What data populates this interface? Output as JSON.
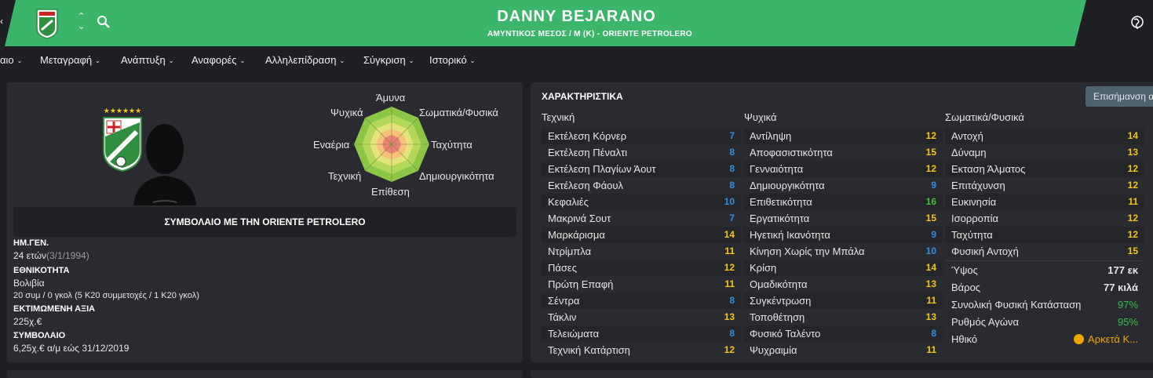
{
  "header": {
    "name": "DANNY BEJARANO",
    "subtitle": "ΑΜΥΝΤΙΚΟΣ ΜΕΣΟΣ / Μ (Κ) - ORIENTE PETROLERO",
    "updown_icon": "⌃⌄",
    "left_fragment": "‹"
  },
  "menu": [
    {
      "label": "αιο"
    },
    {
      "label": "Μεταγραφή"
    },
    {
      "label": "Ανάπτυξη"
    },
    {
      "label": "Αναφορές"
    },
    {
      "label": "Αλληλεπίδραση"
    },
    {
      "label": "Σύγκριση"
    },
    {
      "label": "Ιστορικό"
    }
  ],
  "radar": {
    "labels": [
      "Άμυνα",
      "Σωματικά/Φυσικά",
      "Ταχύτητα",
      "Δημιουργικότητα",
      "Επίθεση",
      "Τεχνική",
      "Εναέρια",
      "Ψυχικά"
    ]
  },
  "contract": {
    "title": "ΣΥΜΒΟΛΑΙΟ ΜΕ ΤΗΝ ORIENTE PETROLERO",
    "dob_label": "ΗΜ.ΓΕΝ.",
    "age": "24 ετών",
    "dob": "(3/1/1994)",
    "nationality_label": "ΕΘΝΙΚΟΤΗΤΑ",
    "nationality": "Βολιβία",
    "caps": "20 συμ / 0 γκολ (5 Κ20 συμμετοχές / 1 Κ20 γκολ)",
    "value_label": "ΕΚΤΙΜΩΜΕΝΗ ΑΞΙΑ",
    "value": "225χ.€",
    "contract_label": "ΣΥΜΒΟΛΑΙΟ",
    "contract_value": "6,25χ.€ α/μ εώς 31/12/2019"
  },
  "attributes": {
    "title": "ΧΑΡΑΚΤΗΡΙΣΤΙΚΑ",
    "highlight_button": "Επισήμανση α",
    "columns": [
      {
        "heading": "Τεχνική",
        "rows": [
          {
            "name": "Εκτέλεση Κόρνερ",
            "value": "7"
          },
          {
            "name": "Εκτέλεση Πέναλτι",
            "value": "8"
          },
          {
            "name": "Εκτέλεση Πλαγίων Άουτ",
            "value": "8"
          },
          {
            "name": "Εκτέλεση Φάουλ",
            "value": "8"
          },
          {
            "name": "Κεφαλιές",
            "value": "10"
          },
          {
            "name": "Μακρινά Σουτ",
            "value": "7"
          },
          {
            "name": "Μαρκάρισμα",
            "value": "14"
          },
          {
            "name": "Ντρίμπλα",
            "value": "11"
          },
          {
            "name": "Πάσες",
            "value": "12"
          },
          {
            "name": "Πρώτη Επαφή",
            "value": "11"
          },
          {
            "name": "Σέντρα",
            "value": "8"
          },
          {
            "name": "Τάκλιν",
            "value": "13"
          },
          {
            "name": "Τελειώματα",
            "value": "8"
          },
          {
            "name": "Τεχνική Κατάρτιση",
            "value": "12"
          }
        ]
      },
      {
        "heading": "Ψυχικά",
        "rows": [
          {
            "name": "Αντίληψη",
            "value": "12"
          },
          {
            "name": "Αποφασιστικότητα",
            "value": "15"
          },
          {
            "name": "Γενναιότητα",
            "value": "12"
          },
          {
            "name": "Δημιουργικότητα",
            "value": "9"
          },
          {
            "name": "Επιθετικότητα",
            "value": "16"
          },
          {
            "name": "Εργατικότητα",
            "value": "15"
          },
          {
            "name": "Ηγετική Ικανότητα",
            "value": "9"
          },
          {
            "name": "Κίνηση Χωρίς την Μπάλα",
            "value": "10"
          },
          {
            "name": "Κρίση",
            "value": "14"
          },
          {
            "name": "Ομαδικότητα",
            "value": "13"
          },
          {
            "name": "Συγκέντρωση",
            "value": "11"
          },
          {
            "name": "Τοποθέτηση",
            "value": "13"
          },
          {
            "name": "Φυσικό Ταλέντο",
            "value": "8"
          },
          {
            "name": "Ψυχραιμία",
            "value": "11"
          }
        ]
      },
      {
        "heading": "Σωματικά/Φυσικά",
        "rows": [
          {
            "name": "Αντοχή",
            "value": "14"
          },
          {
            "name": "Δύναμη",
            "value": "13"
          },
          {
            "name": "Εκταση Άλματος",
            "value": "12"
          },
          {
            "name": "Επιτάχυνση",
            "value": "12"
          },
          {
            "name": "Ευκινησία",
            "value": "11"
          },
          {
            "name": "Ισορροπία",
            "value": "12"
          },
          {
            "name": "Ταχύτητα",
            "value": "12"
          },
          {
            "name": "Φυσική Αντοχή",
            "value": "15"
          }
        ]
      }
    ],
    "extra": [
      {
        "name": "Ύψος",
        "value": "177 εκ"
      },
      {
        "name": "Βάρος",
        "value": "77 κιλά"
      },
      {
        "name": "Συνολική Φυσική Κατάσταση",
        "value": "97%"
      },
      {
        "name": "Ρυθμός Αγώνα",
        "value": "95%"
      },
      {
        "name": "Ηθικό",
        "value": "Αρκετά Κ..."
      }
    ]
  },
  "colors": {
    "header_green": "#3bb56a",
    "value_blue": "#2f8fe0",
    "value_yellow": "#f5c518",
    "value_green": "#3ec43e",
    "percent_green": "#39c04a",
    "morale_orange": "#f0a500"
  },
  "icons": [
    "search-icon",
    "globe-icon",
    "club-badge-icon",
    "player-silhouette-icon",
    "morale-icon",
    "chevron-down-icon"
  ]
}
